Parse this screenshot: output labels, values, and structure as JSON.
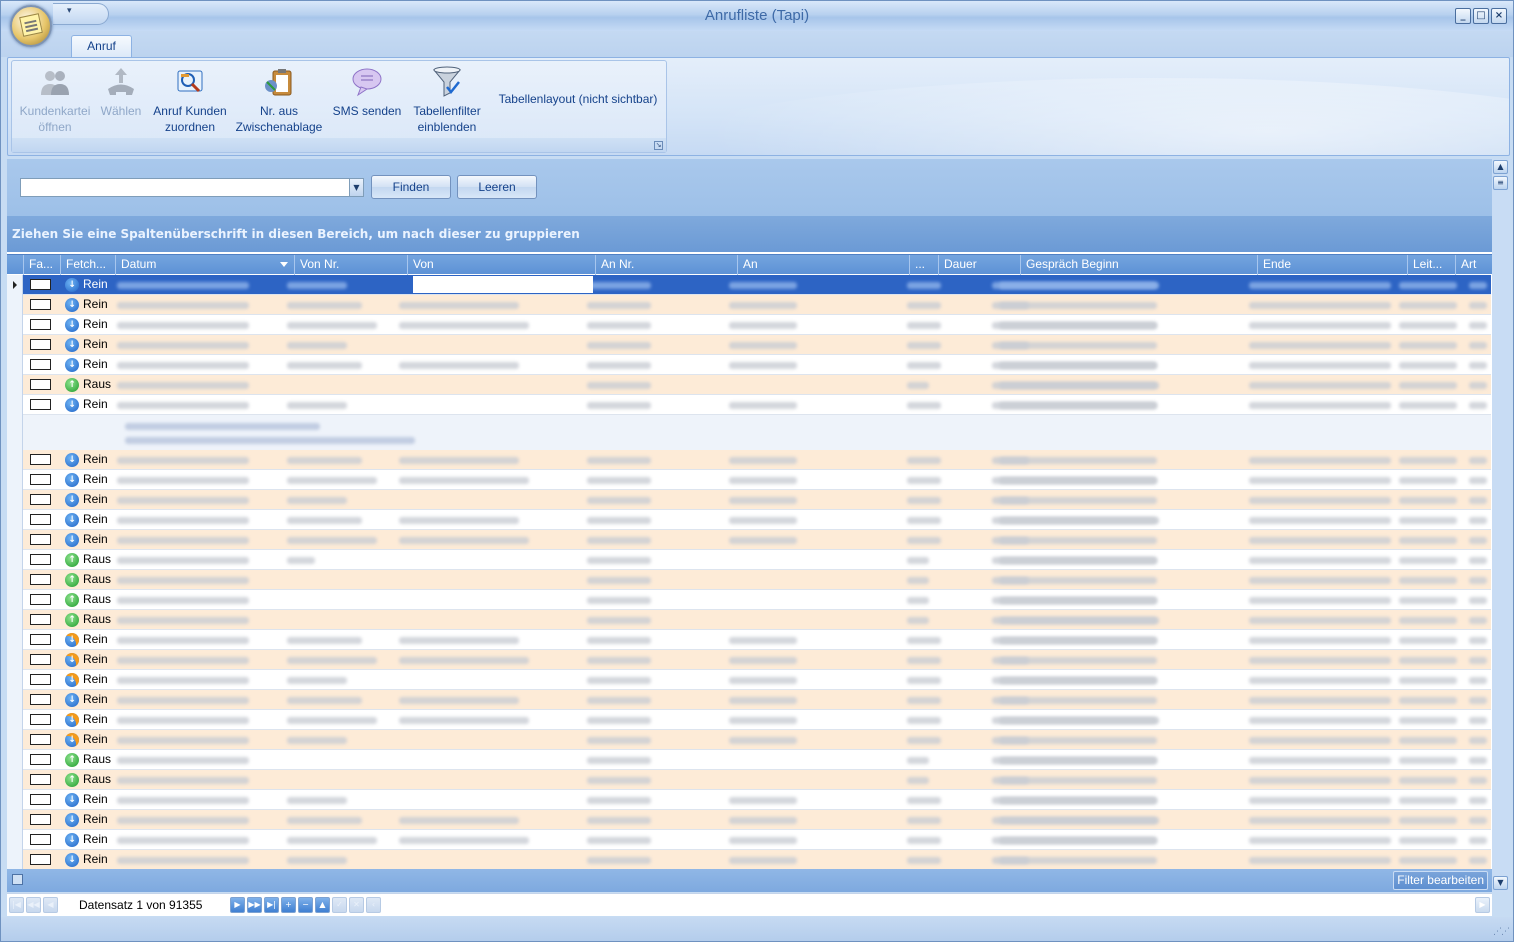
{
  "window": {
    "title": "Anrufliste (Tapi)"
  },
  "ribbon": {
    "tabs": [
      "Anruf"
    ],
    "buttons": [
      {
        "id": "kundenkartei",
        "line1": "Kundenkartei",
        "line2": "öffnen",
        "icon": "contacts-icon",
        "enabled": false
      },
      {
        "id": "waehlen",
        "line1": "Wählen",
        "line2": "",
        "icon": "phone-icon",
        "enabled": false
      },
      {
        "id": "zuordnen",
        "line1": "Anruf Kunden",
        "line2": "zuordnen",
        "icon": "assign-customer-icon",
        "enabled": true
      },
      {
        "id": "zwischenablage",
        "line1": "Nr. aus",
        "line2": "Zwischenablage",
        "icon": "clipboard-icon",
        "enabled": true
      },
      {
        "id": "sms",
        "line1": "SMS senden",
        "line2": "",
        "icon": "sms-bubble-icon",
        "enabled": true
      },
      {
        "id": "filter",
        "line1": "Tabellenfilter",
        "line2": "einblenden",
        "icon": "funnel-icon",
        "enabled": true
      },
      {
        "id": "layout",
        "line1": "Tabellenlayout (nicht sichtbar)",
        "line2": "",
        "icon": "",
        "enabled": true
      }
    ]
  },
  "search": {
    "find_label": "Finden",
    "clear_label": "Leeren",
    "value": ""
  },
  "groupbar": {
    "hint": "Ziehen Sie eine Spaltenüberschrift in diesen Bereich, um nach dieser zu gruppieren"
  },
  "grid": {
    "columns": [
      "Fa...",
      "Fetch...",
      "Datum",
      "Von Nr.",
      "Von",
      "An Nr.",
      "An",
      "...",
      "Dauer",
      "Gespräch Beginn",
      "Ende",
      "Leit...",
      "Art"
    ],
    "sorted_column": "Datum",
    "rows": [
      {
        "dir": "in",
        "text": "Rein",
        "selected": true
      },
      {
        "dir": "in",
        "text": "Rein"
      },
      {
        "dir": "in",
        "text": "Rein"
      },
      {
        "dir": "in",
        "text": "Rein"
      },
      {
        "dir": "in",
        "text": "Rein"
      },
      {
        "dir": "out",
        "text": "Raus"
      },
      {
        "dir": "in",
        "text": "Rein",
        "detail": true
      },
      {
        "dir": "in",
        "text": "Rein"
      },
      {
        "dir": "in",
        "text": "Rein"
      },
      {
        "dir": "in",
        "text": "Rein"
      },
      {
        "dir": "in",
        "text": "Rein"
      },
      {
        "dir": "in",
        "text": "Rein"
      },
      {
        "dir": "out",
        "text": "Raus"
      },
      {
        "dir": "out",
        "text": "Raus"
      },
      {
        "dir": "out",
        "text": "Raus"
      },
      {
        "dir": "out",
        "text": "Raus"
      },
      {
        "dir": "inx",
        "text": "Rein"
      },
      {
        "dir": "inx",
        "text": "Rein"
      },
      {
        "dir": "inx",
        "text": "Rein"
      },
      {
        "dir": "in",
        "text": "Rein"
      },
      {
        "dir": "inx",
        "text": "Rein"
      },
      {
        "dir": "inx",
        "text": "Rein"
      },
      {
        "dir": "out",
        "text": "Raus"
      },
      {
        "dir": "out",
        "text": "Raus"
      },
      {
        "dir": "in",
        "text": "Rein"
      },
      {
        "dir": "in",
        "text": "Rein"
      },
      {
        "dir": "in",
        "text": "Rein"
      },
      {
        "dir": "in",
        "text": "Rein"
      }
    ]
  },
  "footer": {
    "filter_label": "Filter bearbeiten"
  },
  "navigator": {
    "record_text": "Datensatz 1 von 91355"
  },
  "colors": {
    "selection": "#2d64c4",
    "alt_row": "#fdebd7",
    "header": "#5d92d6"
  }
}
